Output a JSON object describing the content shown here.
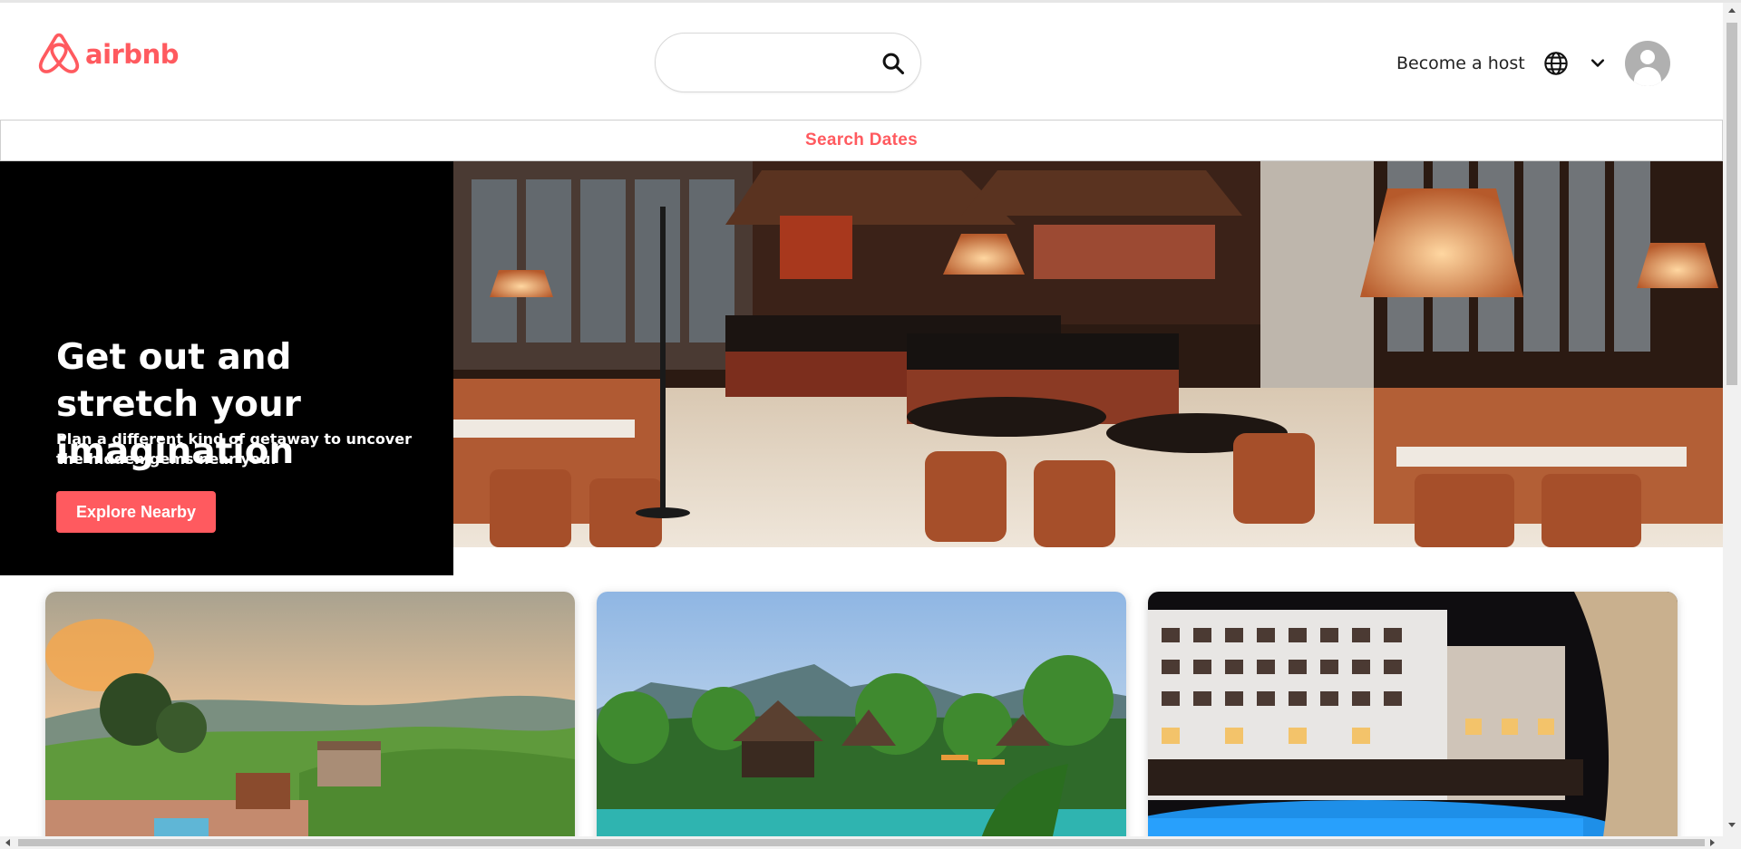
{
  "header": {
    "logo_text": "airbnb",
    "search": {
      "value": "",
      "placeholder": ""
    },
    "become_host_label": "Become a host"
  },
  "search_dates_label": "Search Dates",
  "hero": {
    "title": "Get out and stretch your imagination",
    "subtitle": "Plan a different kind of getaway to uncover the hidden gems near you.",
    "button_label": "Explore Nearby"
  },
  "icons": {
    "logo": "airbnb-logo-icon",
    "search": "search-icon",
    "globe": "globe-icon",
    "chevron": "chevron-down-icon",
    "avatar": "user-avatar-icon"
  },
  "colors": {
    "brand": "#ff5a5f",
    "hero_background": "#000000",
    "text": "#222222"
  }
}
